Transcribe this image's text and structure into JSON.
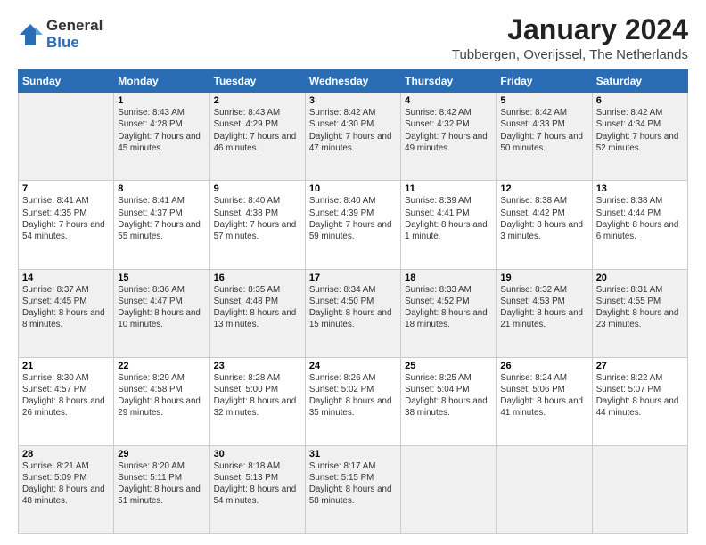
{
  "logo": {
    "general": "General",
    "blue": "Blue"
  },
  "title": "January 2024",
  "subtitle": "Tubbergen, Overijssel, The Netherlands",
  "days_header": [
    "Sunday",
    "Monday",
    "Tuesday",
    "Wednesday",
    "Thursday",
    "Friday",
    "Saturday"
  ],
  "weeks": [
    [
      {
        "num": "",
        "sunrise": "",
        "sunset": "",
        "daylight": ""
      },
      {
        "num": "1",
        "sunrise": "Sunrise: 8:43 AM",
        "sunset": "Sunset: 4:28 PM",
        "daylight": "Daylight: 7 hours and 45 minutes."
      },
      {
        "num": "2",
        "sunrise": "Sunrise: 8:43 AM",
        "sunset": "Sunset: 4:29 PM",
        "daylight": "Daylight: 7 hours and 46 minutes."
      },
      {
        "num": "3",
        "sunrise": "Sunrise: 8:42 AM",
        "sunset": "Sunset: 4:30 PM",
        "daylight": "Daylight: 7 hours and 47 minutes."
      },
      {
        "num": "4",
        "sunrise": "Sunrise: 8:42 AM",
        "sunset": "Sunset: 4:32 PM",
        "daylight": "Daylight: 7 hours and 49 minutes."
      },
      {
        "num": "5",
        "sunrise": "Sunrise: 8:42 AM",
        "sunset": "Sunset: 4:33 PM",
        "daylight": "Daylight: 7 hours and 50 minutes."
      },
      {
        "num": "6",
        "sunrise": "Sunrise: 8:42 AM",
        "sunset": "Sunset: 4:34 PM",
        "daylight": "Daylight: 7 hours and 52 minutes."
      }
    ],
    [
      {
        "num": "7",
        "sunrise": "Sunrise: 8:41 AM",
        "sunset": "Sunset: 4:35 PM",
        "daylight": "Daylight: 7 hours and 54 minutes."
      },
      {
        "num": "8",
        "sunrise": "Sunrise: 8:41 AM",
        "sunset": "Sunset: 4:37 PM",
        "daylight": "Daylight: 7 hours and 55 minutes."
      },
      {
        "num": "9",
        "sunrise": "Sunrise: 8:40 AM",
        "sunset": "Sunset: 4:38 PM",
        "daylight": "Daylight: 7 hours and 57 minutes."
      },
      {
        "num": "10",
        "sunrise": "Sunrise: 8:40 AM",
        "sunset": "Sunset: 4:39 PM",
        "daylight": "Daylight: 7 hours and 59 minutes."
      },
      {
        "num": "11",
        "sunrise": "Sunrise: 8:39 AM",
        "sunset": "Sunset: 4:41 PM",
        "daylight": "Daylight: 8 hours and 1 minute."
      },
      {
        "num": "12",
        "sunrise": "Sunrise: 8:38 AM",
        "sunset": "Sunset: 4:42 PM",
        "daylight": "Daylight: 8 hours and 3 minutes."
      },
      {
        "num": "13",
        "sunrise": "Sunrise: 8:38 AM",
        "sunset": "Sunset: 4:44 PM",
        "daylight": "Daylight: 8 hours and 6 minutes."
      }
    ],
    [
      {
        "num": "14",
        "sunrise": "Sunrise: 8:37 AM",
        "sunset": "Sunset: 4:45 PM",
        "daylight": "Daylight: 8 hours and 8 minutes."
      },
      {
        "num": "15",
        "sunrise": "Sunrise: 8:36 AM",
        "sunset": "Sunset: 4:47 PM",
        "daylight": "Daylight: 8 hours and 10 minutes."
      },
      {
        "num": "16",
        "sunrise": "Sunrise: 8:35 AM",
        "sunset": "Sunset: 4:48 PM",
        "daylight": "Daylight: 8 hours and 13 minutes."
      },
      {
        "num": "17",
        "sunrise": "Sunrise: 8:34 AM",
        "sunset": "Sunset: 4:50 PM",
        "daylight": "Daylight: 8 hours and 15 minutes."
      },
      {
        "num": "18",
        "sunrise": "Sunrise: 8:33 AM",
        "sunset": "Sunset: 4:52 PM",
        "daylight": "Daylight: 8 hours and 18 minutes."
      },
      {
        "num": "19",
        "sunrise": "Sunrise: 8:32 AM",
        "sunset": "Sunset: 4:53 PM",
        "daylight": "Daylight: 8 hours and 21 minutes."
      },
      {
        "num": "20",
        "sunrise": "Sunrise: 8:31 AM",
        "sunset": "Sunset: 4:55 PM",
        "daylight": "Daylight: 8 hours and 23 minutes."
      }
    ],
    [
      {
        "num": "21",
        "sunrise": "Sunrise: 8:30 AM",
        "sunset": "Sunset: 4:57 PM",
        "daylight": "Daylight: 8 hours and 26 minutes."
      },
      {
        "num": "22",
        "sunrise": "Sunrise: 8:29 AM",
        "sunset": "Sunset: 4:58 PM",
        "daylight": "Daylight: 8 hours and 29 minutes."
      },
      {
        "num": "23",
        "sunrise": "Sunrise: 8:28 AM",
        "sunset": "Sunset: 5:00 PM",
        "daylight": "Daylight: 8 hours and 32 minutes."
      },
      {
        "num": "24",
        "sunrise": "Sunrise: 8:26 AM",
        "sunset": "Sunset: 5:02 PM",
        "daylight": "Daylight: 8 hours and 35 minutes."
      },
      {
        "num": "25",
        "sunrise": "Sunrise: 8:25 AM",
        "sunset": "Sunset: 5:04 PM",
        "daylight": "Daylight: 8 hours and 38 minutes."
      },
      {
        "num": "26",
        "sunrise": "Sunrise: 8:24 AM",
        "sunset": "Sunset: 5:06 PM",
        "daylight": "Daylight: 8 hours and 41 minutes."
      },
      {
        "num": "27",
        "sunrise": "Sunrise: 8:22 AM",
        "sunset": "Sunset: 5:07 PM",
        "daylight": "Daylight: 8 hours and 44 minutes."
      }
    ],
    [
      {
        "num": "28",
        "sunrise": "Sunrise: 8:21 AM",
        "sunset": "Sunset: 5:09 PM",
        "daylight": "Daylight: 8 hours and 48 minutes."
      },
      {
        "num": "29",
        "sunrise": "Sunrise: 8:20 AM",
        "sunset": "Sunset: 5:11 PM",
        "daylight": "Daylight: 8 hours and 51 minutes."
      },
      {
        "num": "30",
        "sunrise": "Sunrise: 8:18 AM",
        "sunset": "Sunset: 5:13 PM",
        "daylight": "Daylight: 8 hours and 54 minutes."
      },
      {
        "num": "31",
        "sunrise": "Sunrise: 8:17 AM",
        "sunset": "Sunset: 5:15 PM",
        "daylight": "Daylight: 8 hours and 58 minutes."
      },
      {
        "num": "",
        "sunrise": "",
        "sunset": "",
        "daylight": ""
      },
      {
        "num": "",
        "sunrise": "",
        "sunset": "",
        "daylight": ""
      },
      {
        "num": "",
        "sunrise": "",
        "sunset": "",
        "daylight": ""
      }
    ]
  ]
}
